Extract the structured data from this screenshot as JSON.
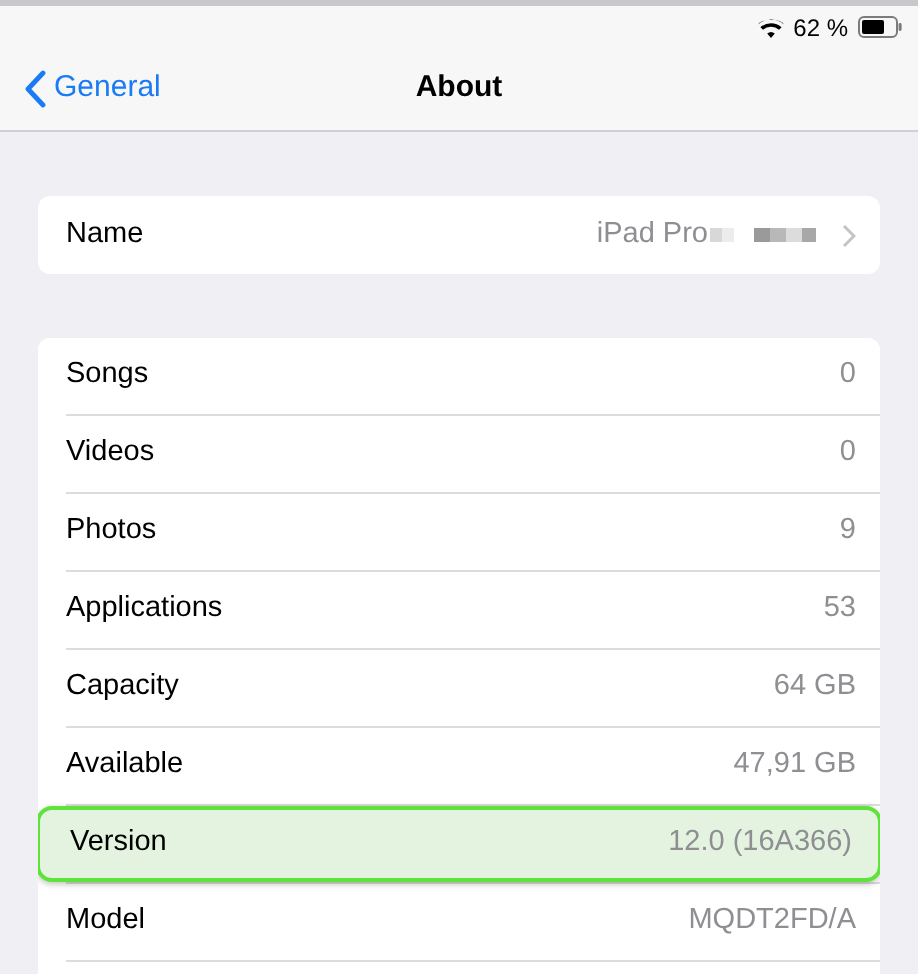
{
  "status_bar": {
    "battery": "62 %"
  },
  "nav": {
    "back": "General",
    "title": "About"
  },
  "name_row": {
    "label": "Name",
    "value": "iPad Pro"
  },
  "rows": [
    {
      "label": "Songs",
      "value": "0",
      "highlighted": false
    },
    {
      "label": "Videos",
      "value": "0",
      "highlighted": false
    },
    {
      "label": "Photos",
      "value": "9",
      "highlighted": false
    },
    {
      "label": "Applications",
      "value": "53",
      "highlighted": false
    },
    {
      "label": "Capacity",
      "value": "64 GB",
      "highlighted": false
    },
    {
      "label": "Available",
      "value": "47,91 GB",
      "highlighted": false
    },
    {
      "label": "Version",
      "value": "12.0 (16A366)",
      "highlighted": true
    },
    {
      "label": "Model",
      "value": "MQDT2FD/A",
      "highlighted": false
    }
  ]
}
